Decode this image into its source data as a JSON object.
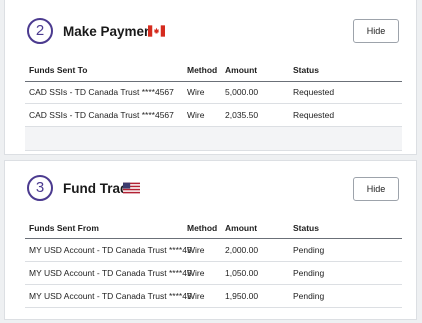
{
  "make_payments": {
    "step": "2",
    "title": "Make Payments",
    "hide_label": "Hide",
    "columns": [
      "Funds Sent To",
      "Method",
      "Amount",
      "Status"
    ],
    "rows": [
      [
        "CAD SSIs - TD Canada Trust ****4567",
        "Wire",
        "5,000.00",
        "Requested"
      ],
      [
        "CAD SSIs - TD Canada Trust ****4567",
        "Wire",
        "2,035.50",
        "Requested"
      ]
    ]
  },
  "fund_trade": {
    "step": "3",
    "title": "Fund Trade",
    "hide_label": "Hide",
    "columns": [
      "Funds Sent From",
      "Method",
      "Amount",
      "Status"
    ],
    "rows": [
      [
        "MY USD Account - TD Canada Trust ****45",
        "Wire",
        "2,000.00",
        "Pending"
      ],
      [
        "MY USD Account - TD Canada Trust ****45",
        "Wire",
        "1,050.00",
        "Pending"
      ],
      [
        "MY USD Account - TD Canada Trust ****45",
        "Wire",
        "1,950.00",
        "Pending"
      ]
    ]
  },
  "colors": {
    "accent": "#4b3a8f",
    "ca_red": "#d52b1e",
    "us_blue": "#3c3b6e",
    "us_red": "#b22234"
  },
  "icons": {
    "ca_flag": "canada-flag-icon",
    "us_flag": "usa-flag-icon"
  }
}
